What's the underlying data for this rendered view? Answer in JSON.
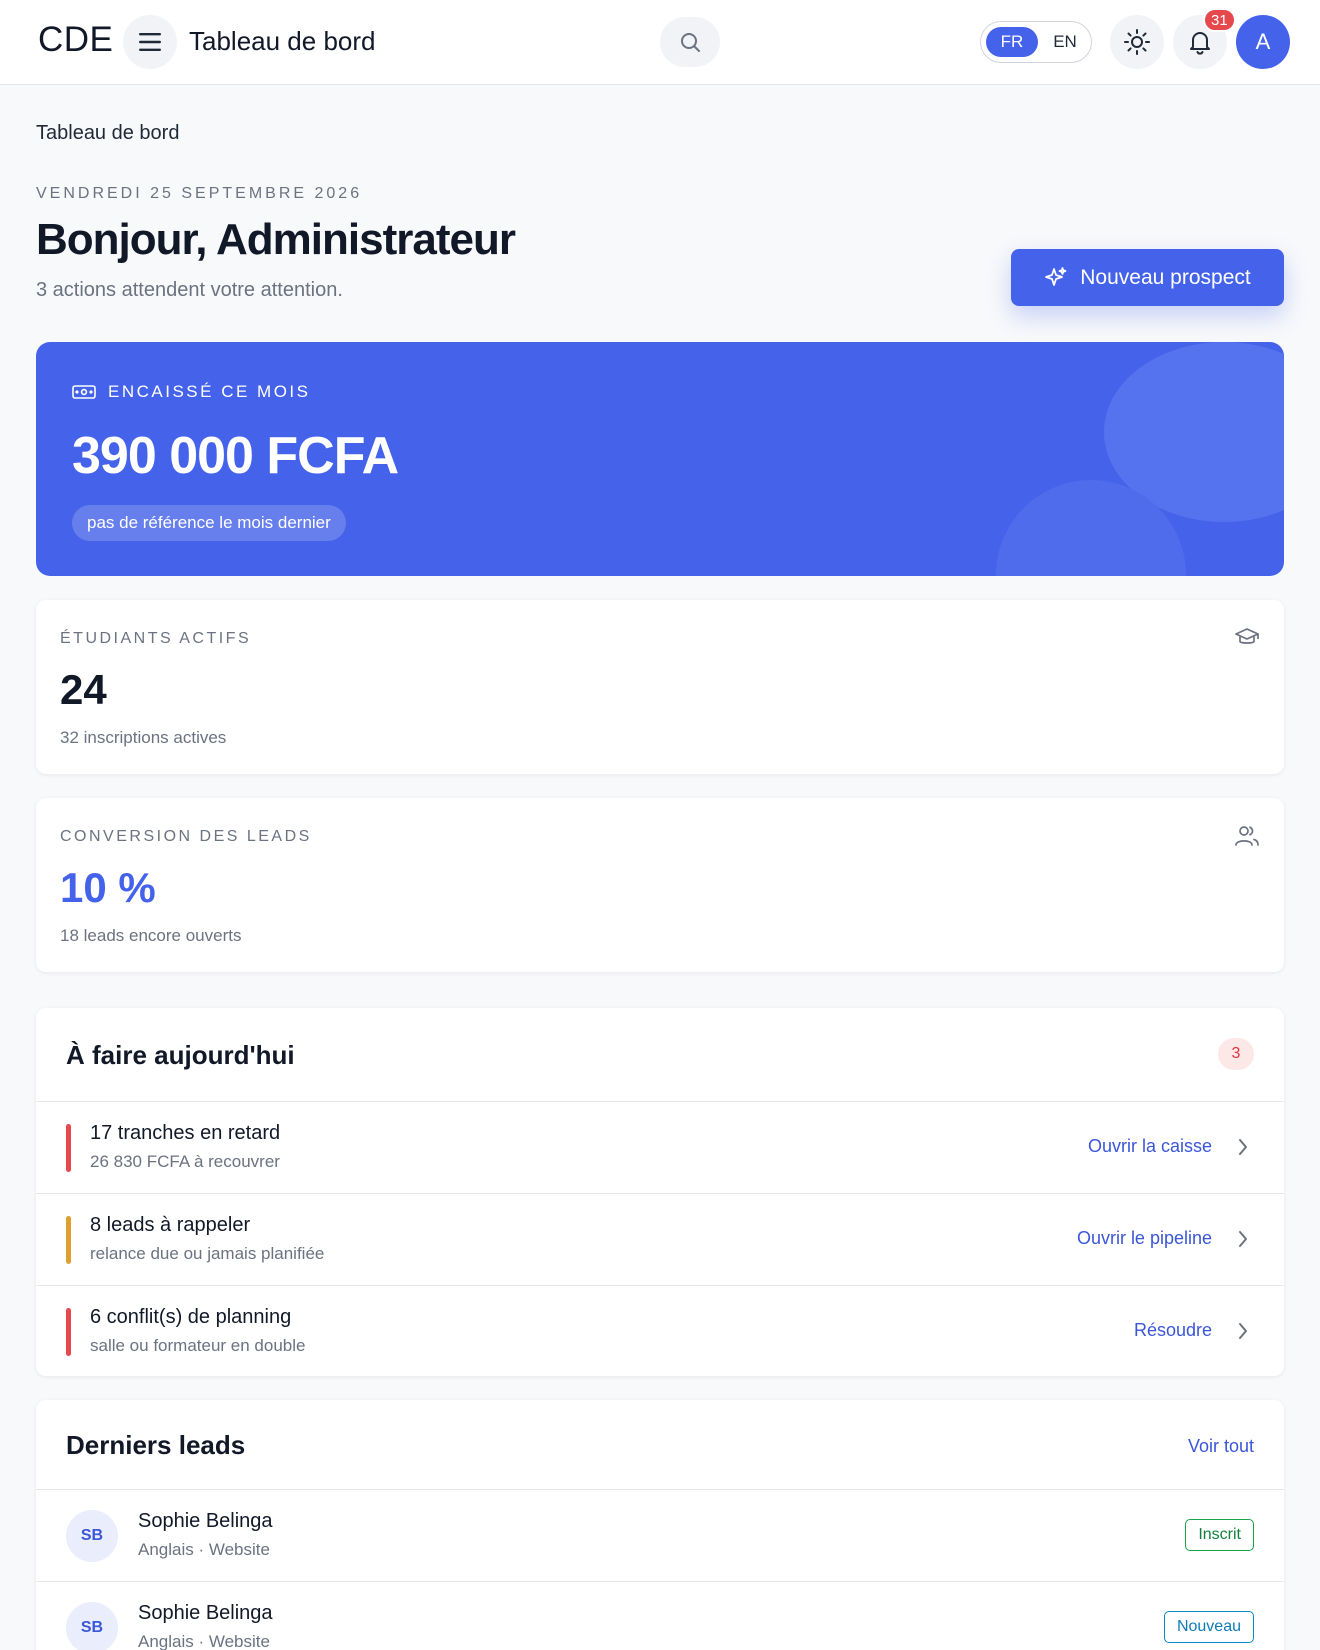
{
  "header": {
    "logo": "CDE",
    "title": "Tableau de bord",
    "lang_fr": "FR",
    "lang_en": "EN",
    "notification_count": "31",
    "avatar_initial": "A",
    "icons": [
      "menu-icon",
      "search-icon",
      "sun-icon",
      "bell-icon"
    ]
  },
  "page": {
    "breadcrumb": "Tableau de bord",
    "date": "VENDREDI 25 SEPTEMBRE 2026",
    "greeting": "Bonjour, Administrateur",
    "subtitle": "3 actions attendent votre attention.",
    "new_prospect_label": "Nouveau prospect"
  },
  "hero": {
    "label": "ENCAISSÉ CE MOIS",
    "amount": "390 000 FCFA",
    "note": "pas de référence le mois dernier"
  },
  "stats": [
    {
      "label": "ÉTUDIANTS ACTIFS",
      "value": "24",
      "sub": "32 inscriptions actives",
      "icon": "graduation-cap-icon"
    },
    {
      "label": "CONVERSION DES LEADS",
      "value": "10 %",
      "sub": "18 leads encore ouverts",
      "icon": "users-icon"
    }
  ],
  "todo": {
    "title": "À faire aujourd'hui",
    "count": "3",
    "items": [
      {
        "title": "17 tranches en retard",
        "desc": "26 830 FCFA à recouvrer",
        "link": "Ouvrir la caisse",
        "color": "#e5484d"
      },
      {
        "title": "8 leads à rappeler",
        "desc": "relance due ou jamais planifiée",
        "link": "Ouvrir le pipeline",
        "color": "#e0a030"
      },
      {
        "title": "6 conflit(s) de planning",
        "desc": "salle ou formateur en double",
        "link": "Résoudre",
        "color": "#e5484d"
      }
    ]
  },
  "leads": {
    "title": "Derniers leads",
    "see_all": "Voir tout",
    "items": [
      {
        "initials": "SB",
        "name": "Sophie Belinga",
        "meta": "Anglais · Website",
        "status": "Inscrit"
      },
      {
        "initials": "SB",
        "name": "Sophie Belinga",
        "meta": "Anglais · Website",
        "status": "Nouveau"
      }
    ]
  },
  "colors": {
    "primary": "#4563ea",
    "danger": "#e5484d",
    "warning": "#e0a030",
    "success": "#16a34a",
    "info": "#0e8ac7"
  }
}
